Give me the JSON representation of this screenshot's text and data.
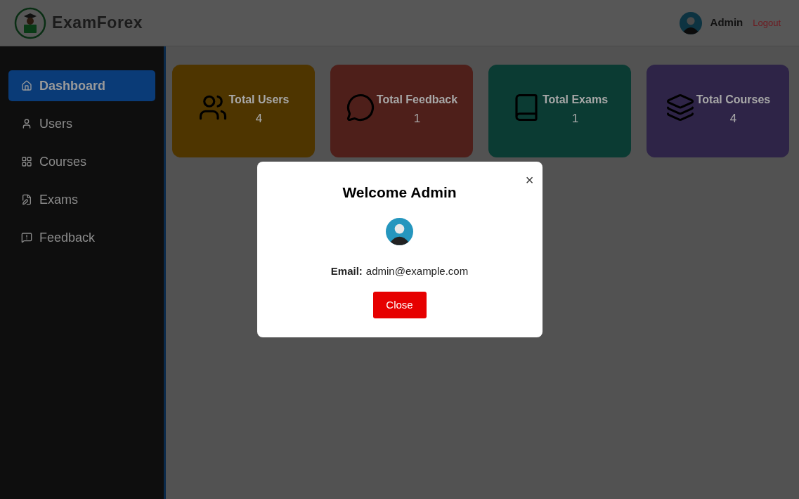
{
  "header": {
    "brand": "ExamForex",
    "user_name": "Admin",
    "logout": "Logout"
  },
  "sidebar": {
    "items": [
      {
        "label": "Dashboard",
        "selected": true
      },
      {
        "label": "Users",
        "selected": false
      },
      {
        "label": "Courses",
        "selected": false
      },
      {
        "label": "Exams",
        "selected": false
      },
      {
        "label": "Feedback",
        "selected": false
      }
    ]
  },
  "stats": [
    {
      "title": "Total Users",
      "value": "4",
      "color": "#4e3500"
    },
    {
      "title": "Total Feedback",
      "value": "1",
      "color": "#4e1f1a"
    },
    {
      "title": "Total Exams",
      "value": "1",
      "color": "#0b3b33"
    },
    {
      "title": "Total Courses",
      "value": "4",
      "color": "#2e2447"
    }
  ],
  "modal": {
    "title": "Welcome Admin",
    "email_label": "Email:",
    "email": "admin@example.com",
    "close_button": "Close",
    "close_icon": "×"
  }
}
